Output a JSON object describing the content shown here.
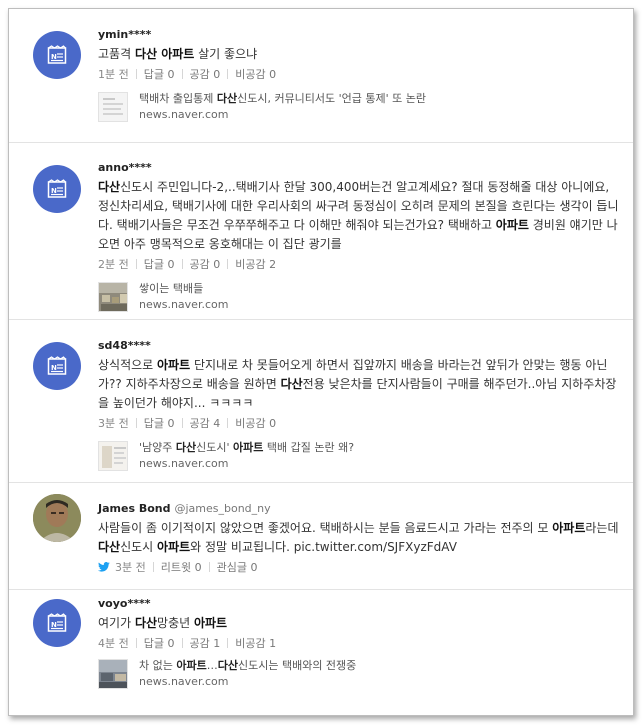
{
  "posts": [
    {
      "author": "ymin****",
      "text": [
        {
          "t": "고품격 "
        },
        {
          "t": "다산 아파트",
          "b": true
        },
        {
          "t": " 살기 좋으냐"
        }
      ],
      "time": "1분 전",
      "replies": "답글 0",
      "likes": "공감 0",
      "dislikes": "비공감 0",
      "link": {
        "title": [
          {
            "t": "택배차 출입통제 "
          },
          {
            "t": "다산",
            "b": true
          },
          {
            "t": "신도시, 커뮤니티서도 '언급 통제' 또 논란"
          }
        ],
        "domain": "news.naver.com"
      }
    },
    {
      "author": "anno****",
      "text": [
        {
          "t": "다산",
          "b": true
        },
        {
          "t": "신도시 주민입니다-2,..택배기사 한달 300,400버는건 알고계세요? 절대 동정해줄 대상 아니에요, 정신차리세요, 택배기사에 대한 우리사회의 싸구려 동정심이 오히려 문제의 본질을 흐린다는 생각이 듭니다. 택배기사들은 무조건 우쭈쭈해주고 다 이해만 해줘야 되는건가요? 택배하고 "
        },
        {
          "t": "아파트",
          "b": true
        },
        {
          "t": " 경비원 얘기만 나오면 아주 맹목적으로 옹호해대는 이 집단 광기를"
        }
      ],
      "time": "2분 전",
      "replies": "답글 0",
      "likes": "공감 0",
      "dislikes": "비공감 2",
      "link": {
        "title": [
          {
            "t": "쌓이는 택배들"
          }
        ],
        "domain": "news.naver.com"
      }
    },
    {
      "author": "sd48****",
      "text": [
        {
          "t": "상식적으로 "
        },
        {
          "t": "아파트",
          "b": true
        },
        {
          "t": " 단지내로 차 못들어오게 하면서 집앞까지 배송을 바라는건 앞뒤가 안맞는 행동 아닌가?? 지하주차장으로 배송을 원하면 "
        },
        {
          "t": "다산",
          "b": true
        },
        {
          "t": "전용 낮은차를 단지사람들이 구매를 해주던가..아님 지하주차장을 높이던가 해야지... ㅋㅋㅋㅋ"
        }
      ],
      "time": "3분 전",
      "replies": "답글 0",
      "likes": "공감 4",
      "dislikes": "비공감 0",
      "link": {
        "title": [
          {
            "t": "'남양주 "
          },
          {
            "t": "다산",
            "b": true
          },
          {
            "t": "신도시' "
          },
          {
            "t": "아파트",
            "b": true
          },
          {
            "t": " 택배 갑질 논란 왜?"
          }
        ],
        "domain": "news.naver.com"
      }
    },
    {
      "author": "James Bond",
      "handle": "@james_bond_ny",
      "text": [
        {
          "t": "사람들이 좀 이기적이지 않았으면 좋겠어요. 택배하시는 분들 음료드시고 가라는 전주의 모 "
        },
        {
          "t": "아파트",
          "b": true
        },
        {
          "t": "라는데 "
        },
        {
          "t": "다산",
          "b": true
        },
        {
          "t": "신도시 "
        },
        {
          "t": "아파트",
          "b": true
        },
        {
          "t": "와 정말 비교됩니다. pic.twitter.com/SJFXyzFdAV"
        }
      ],
      "time": "3분 전",
      "retweets": "리트윗 0",
      "favorites": "관심글 0"
    },
    {
      "author": "voyo****",
      "text": [
        {
          "t": "여기가 "
        },
        {
          "t": "다산",
          "b": true
        },
        {
          "t": "망충년 "
        },
        {
          "t": "아파트",
          "b": true
        }
      ],
      "time": "4분 전",
      "replies": "답글 0",
      "likes": "공감 1",
      "dislikes": "비공감 1",
      "link": {
        "title": [
          {
            "t": "차 없는 "
          },
          {
            "t": "아파트",
            "b": true
          },
          {
            "t": "…"
          },
          {
            "t": "다산",
            "b": true
          },
          {
            "t": "신도시는 택배와의 전쟁중"
          }
        ],
        "domain": "news.naver.com"
      }
    }
  ],
  "icons": {
    "avatar": "news-icon",
    "tweet": "twitter-bird-icon"
  },
  "colors": {
    "avatar_bg": "#4a69c9",
    "twitter_blue": "#1da1f2"
  }
}
